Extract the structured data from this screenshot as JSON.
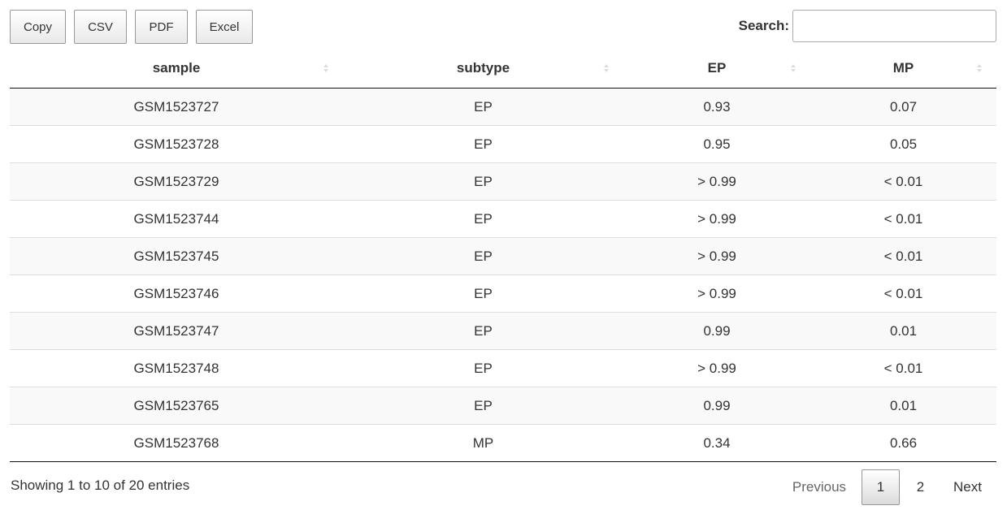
{
  "toolbar": {
    "copy_label": "Copy",
    "csv_label": "CSV",
    "pdf_label": "PDF",
    "excel_label": "Excel"
  },
  "search": {
    "label": "Search:",
    "value": "",
    "placeholder": ""
  },
  "table": {
    "columns": [
      "sample",
      "subtype",
      "EP",
      "MP"
    ],
    "rows": [
      [
        "GSM1523727",
        "EP",
        "0.93",
        "0.07"
      ],
      [
        "GSM1523728",
        "EP",
        "0.95",
        "0.05"
      ],
      [
        "GSM1523729",
        "EP",
        "> 0.99",
        "< 0.01"
      ],
      [
        "GSM1523744",
        "EP",
        "> 0.99",
        "< 0.01"
      ],
      [
        "GSM1523745",
        "EP",
        "> 0.99",
        "< 0.01"
      ],
      [
        "GSM1523746",
        "EP",
        "> 0.99",
        "< 0.01"
      ],
      [
        "GSM1523747",
        "EP",
        "0.99",
        "0.01"
      ],
      [
        "GSM1523748",
        "EP",
        "> 0.99",
        "< 0.01"
      ],
      [
        "GSM1523765",
        "EP",
        "0.99",
        "0.01"
      ],
      [
        "GSM1523768",
        "MP",
        "0.34",
        "0.66"
      ]
    ]
  },
  "footer": {
    "info": "Showing 1 to 10 of 20 entries",
    "pagination": {
      "previous": "Previous",
      "pages": [
        "1",
        "2"
      ],
      "current_page": "1",
      "next": "Next"
    }
  }
}
